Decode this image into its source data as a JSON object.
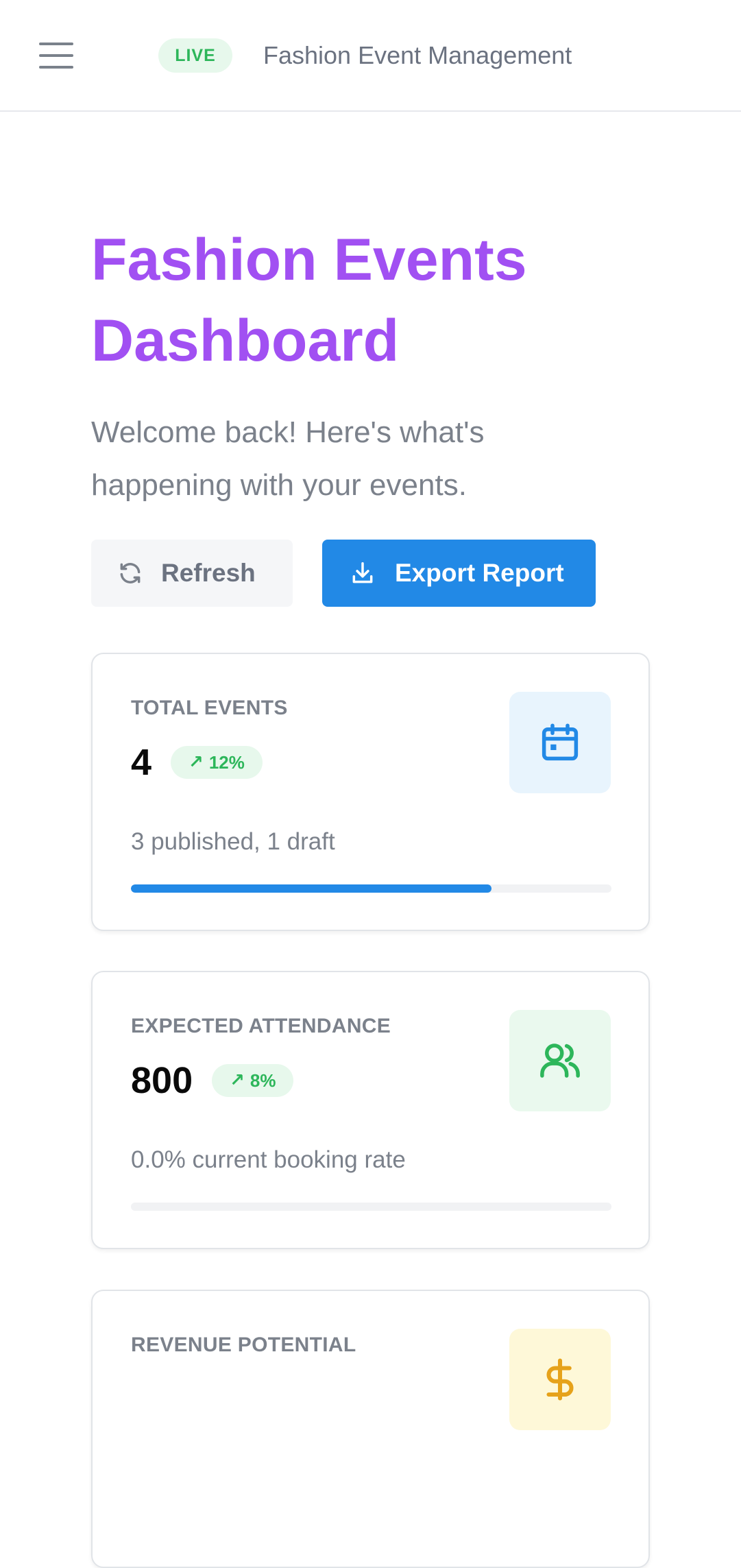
{
  "header": {
    "menu_icon": "hamburger-menu-icon",
    "live_badge": "LIVE",
    "app_title": "Fashion Event Management"
  },
  "hero": {
    "title": "Fashion Events Dashboard",
    "subtitle": "Welcome back! Here's what's happening with your events."
  },
  "actions": {
    "refresh": {
      "label": "Refresh",
      "icon": "refresh-icon"
    },
    "export": {
      "label": "Export Report",
      "icon": "download-icon"
    }
  },
  "stats": [
    {
      "label": "TOTAL EVENTS",
      "value": "4",
      "trend": "12%",
      "icon": "calendar-icon",
      "description": "3 published, 1 draft",
      "progress": 0.75
    },
    {
      "label": "EXPECTED ATTENDANCE",
      "value": "800",
      "trend": "8%",
      "icon": "users-icon",
      "description": "0.0% current booking rate",
      "progress": 0.0
    },
    {
      "label": "REVENUE POTENTIAL",
      "icon": "dollar-icon"
    }
  ],
  "colors": {
    "accent_purple": "#a150f2",
    "primary_blue": "#2289e6",
    "success_green": "#2db65a",
    "icon_bg_blue": "#e8f4fd",
    "icon_bg_green": "#eaf9ee",
    "icon_bg_yellow": "#fef8d8",
    "icon_yellow": "#e6a21a"
  }
}
